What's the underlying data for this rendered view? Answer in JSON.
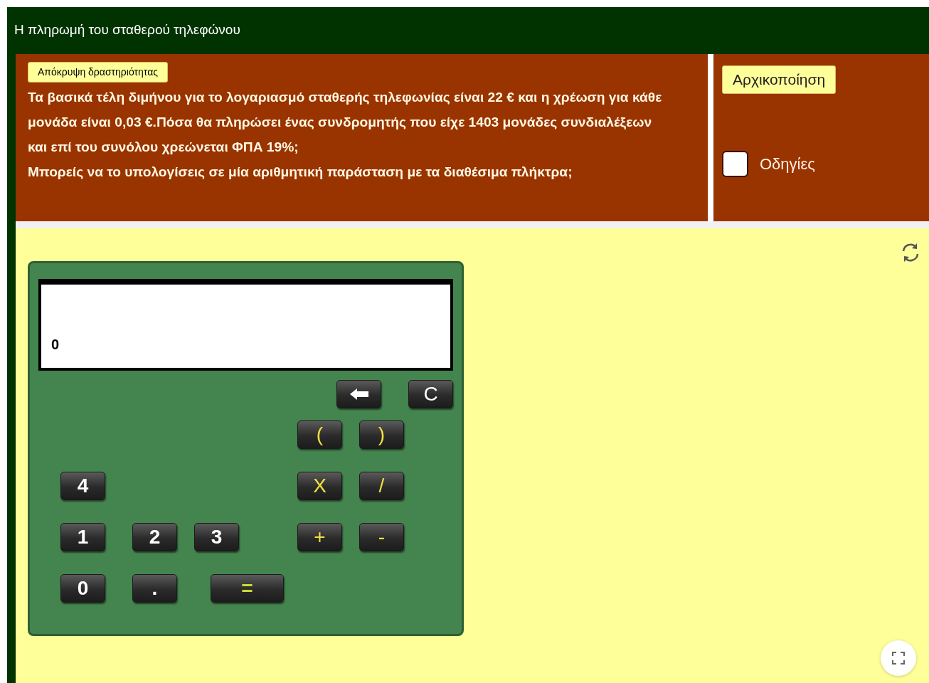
{
  "header": {
    "title": "Η πληρωμή του σταθερού τηλεφώνου"
  },
  "activity": {
    "hide_button": "Απόκρυψη δραστηριότητας",
    "question": [
      "Τα βασικά τέλη διμήνου για το λογαριασμό σταθερής τηλεφωνίας είναι 22 € και η χρέωση για κάθε μονάδα είναι 0,03 €.Πόσα θα πληρώσει ένας συνδρομητής που είχε 1403 μονάδες συνδιαλέξεων και επί του συνόλου χρεώνεται ΦΠΑ 19%;",
      "Μπορείς να το υπολογίσεις σε μία αριθμητική παράσταση με τα διαθέσιμα πλήκτρα;"
    ]
  },
  "side": {
    "reset_button": "Αρχικοποίηση",
    "instructions": {
      "label": "Οδηγίες",
      "checked": false
    }
  },
  "calculator": {
    "display": "0",
    "keys": [
      {
        "kind": "backspace"
      },
      {
        "kind": "clear",
        "label": "C"
      },
      {
        "kind": "operator",
        "label": "("
      },
      {
        "kind": "operator",
        "label": ")"
      },
      {
        "kind": "digit",
        "label": "4"
      },
      {
        "kind": "operator",
        "label": "X"
      },
      {
        "kind": "operator",
        "label": "/"
      },
      {
        "kind": "digit",
        "label": "1"
      },
      {
        "kind": "digit",
        "label": "2"
      },
      {
        "kind": "digit",
        "label": "3"
      },
      {
        "kind": "operator",
        "label": "+"
      },
      {
        "kind": "operator",
        "label": "-"
      },
      {
        "kind": "digit",
        "label": "0"
      },
      {
        "kind": "digit",
        "label": "."
      },
      {
        "kind": "equals",
        "label": "="
      }
    ]
  }
}
